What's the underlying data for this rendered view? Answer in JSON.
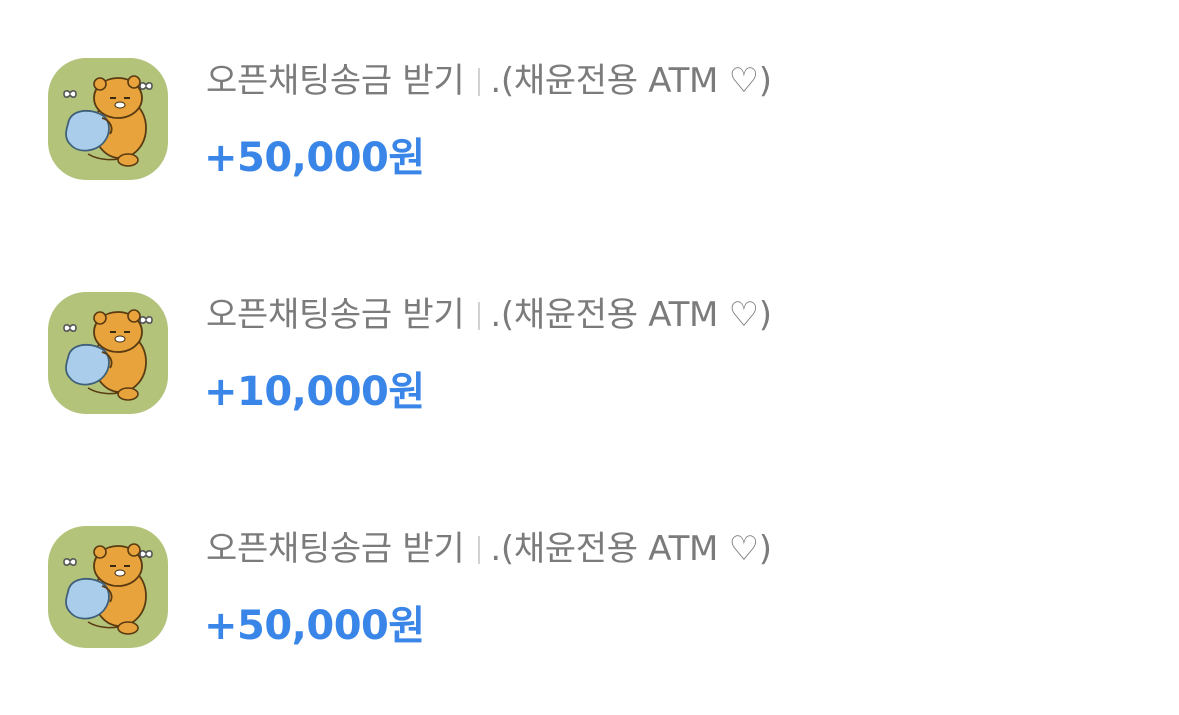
{
  "transactions": [
    {
      "type_label": "오픈채팅송금 받기",
      "counterparty": ".(채윤전용 ATM ♡)",
      "amount": "+50,000원",
      "icon": "ryan-bear-hugging-pillow-icon"
    },
    {
      "type_label": "오픈채팅송금 받기",
      "counterparty": ".(채윤전용 ATM ♡)",
      "amount": "+10,000원",
      "icon": "ryan-bear-hugging-pillow-icon"
    },
    {
      "type_label": "오픈채팅송금 받기",
      "counterparty": ".(채윤전용 ATM ♡)",
      "amount": "+50,000원",
      "icon": "ryan-bear-hugging-pillow-icon"
    }
  ],
  "colors": {
    "amount": "#3a86e8",
    "title": "#7b7b7b",
    "avatar_bg": "#b3c47a",
    "bear": "#e8a33c",
    "pillow": "#a9cdea"
  }
}
